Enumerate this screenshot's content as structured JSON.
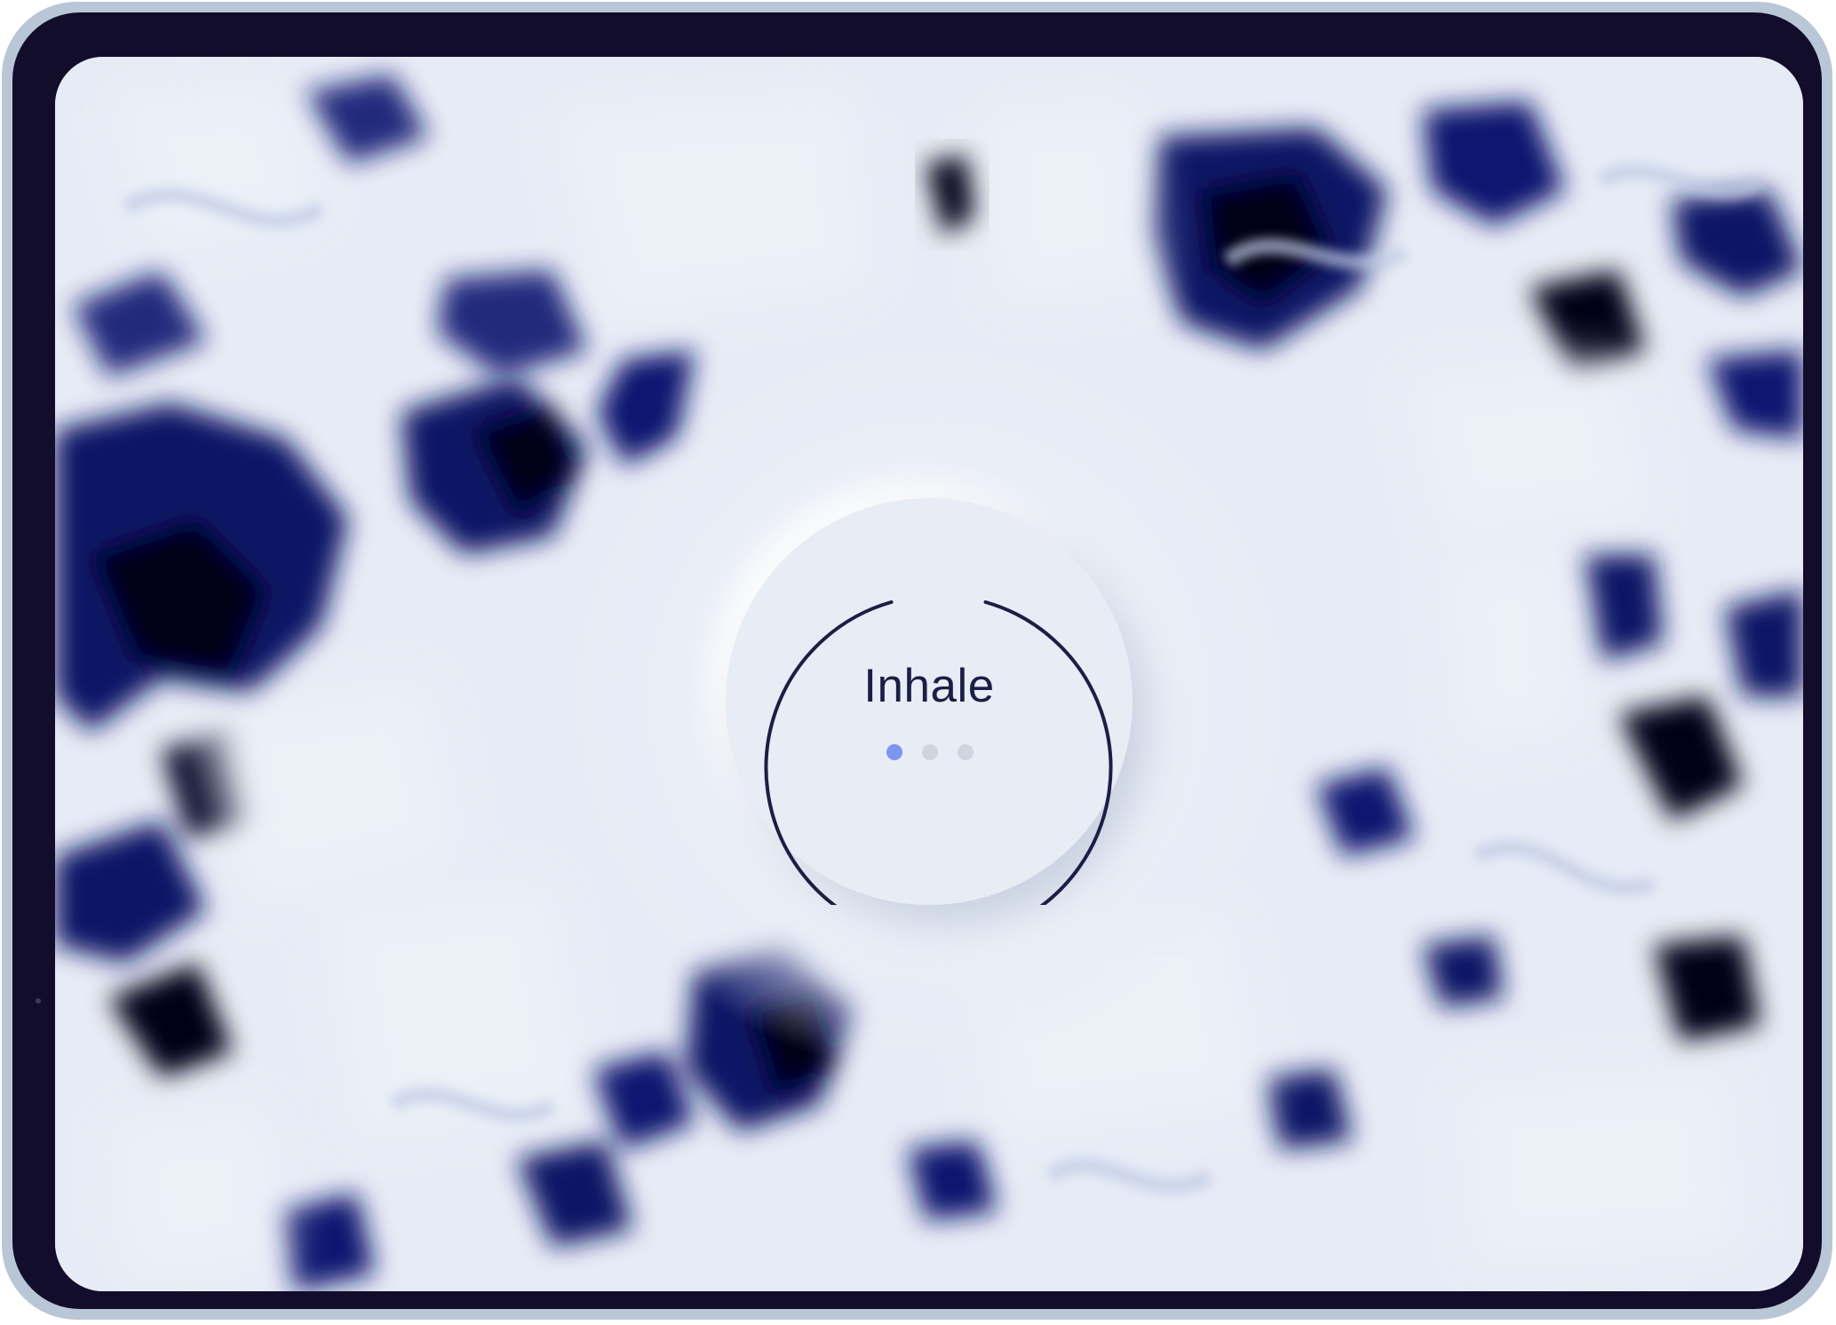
{
  "app": {
    "phase_label": "Inhale",
    "progress_steps": [
      {
        "name": "step-1",
        "active": true
      },
      {
        "name": "step-2",
        "active": false
      },
      {
        "name": "step-3",
        "active": false
      }
    ]
  },
  "colors": {
    "ink": "#1b1f46",
    "accent": "#7a96ef",
    "inactive_dot": "#cfd4de",
    "screen_background": "#e7ebf5",
    "background_navy": "#0b1466",
    "device_frame": "#120d2b"
  }
}
